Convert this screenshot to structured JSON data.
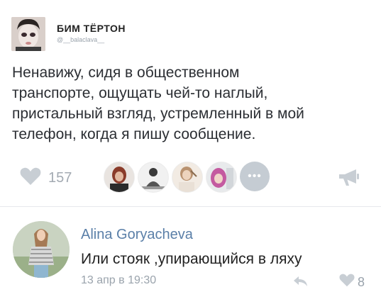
{
  "tweet": {
    "author_name": "БИМ ТЁРТОН",
    "author_handle": "@__balaclava__",
    "text": "Ненавижу, сидя в общественном\nтранспорте, ощущать чей-то наглый,\nпристальный взгляд, устремленный в мой\nтелефон, когда я пишу сообщение.",
    "like_count": "157",
    "more_likers": "•••"
  },
  "comment": {
    "author_name": "Alina Goryacheva",
    "text": "Или стояк ,упирающийся в ляху",
    "date": "13 апр в 19:30",
    "like_count": "8"
  },
  "colors": {
    "link": "#5a7fa8",
    "muted": "#a3aab2",
    "text": "#2b2e33"
  },
  "icons": [
    "heart-icon",
    "megaphone-icon",
    "reply-icon",
    "more-icon"
  ]
}
